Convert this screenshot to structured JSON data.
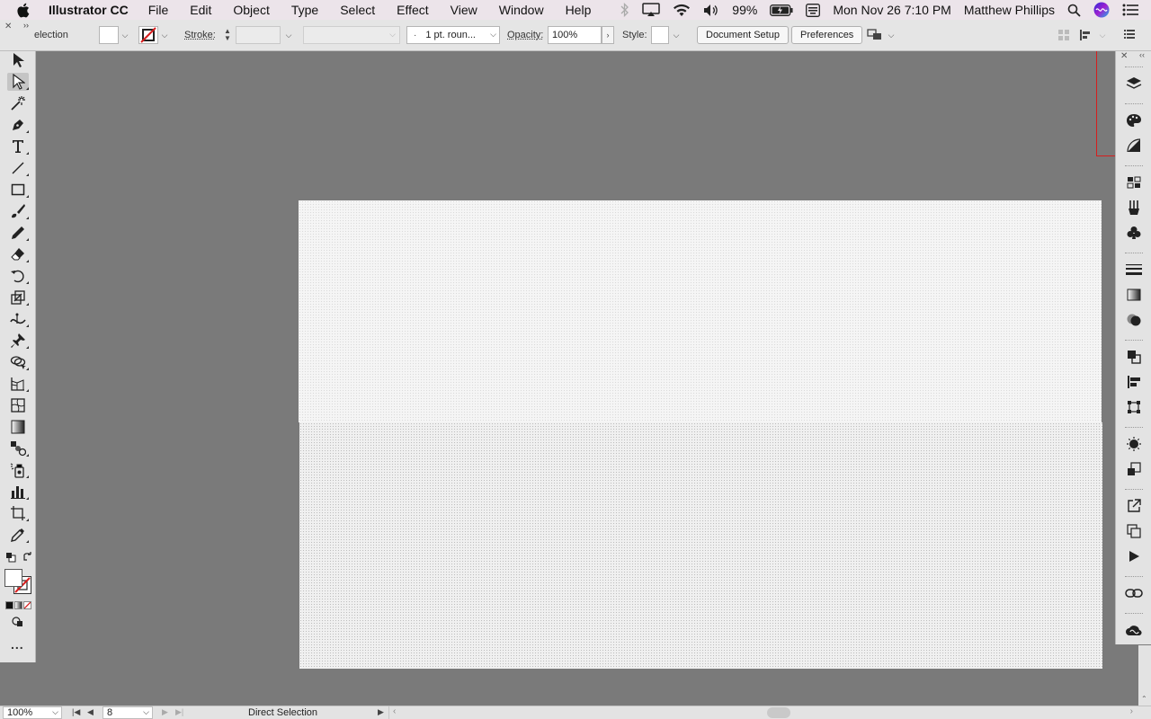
{
  "menubar": {
    "app_name": "Illustrator CC",
    "items": [
      "File",
      "Edit",
      "Object",
      "Type",
      "Select",
      "Effect",
      "View",
      "Window",
      "Help"
    ],
    "battery": "99%",
    "datetime": "Mon Nov 26  7:10 PM",
    "user": "Matthew Phillips"
  },
  "controlbar": {
    "tool_name": "election",
    "stroke_label": "Stroke:",
    "brush_value": "1 pt. roun...",
    "opacity_label": "Opacity:",
    "opacity_value": "100%",
    "style_label": "Style:",
    "document_setup": "Document Setup",
    "preferences": "Preferences"
  },
  "tools": {
    "active": "direct-selection-tool",
    "more": "..."
  },
  "statusbar": {
    "zoom": "100%",
    "artboard_number": "8",
    "current_tool": "Direct Selection"
  },
  "colors": {
    "canvas": "#7a7a7a",
    "panel": "#e3e3e3",
    "accent_red": "#d61e1e"
  }
}
